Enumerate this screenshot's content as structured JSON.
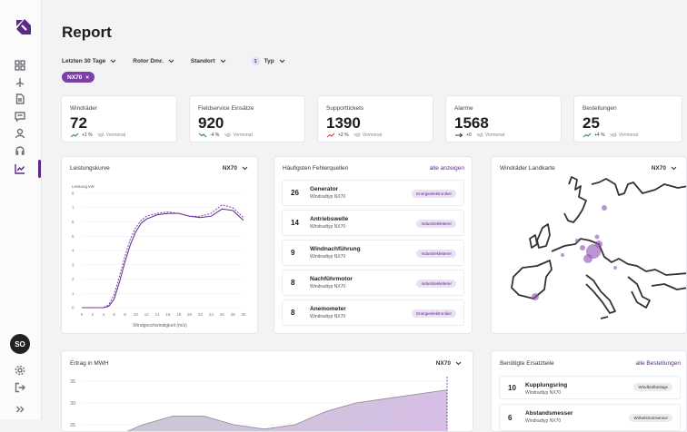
{
  "sidebar": {
    "avatar_initials": "SO",
    "nav_icons": [
      "dashboard-icon",
      "wind-turbine-icon",
      "document-icon",
      "message-icon",
      "user-icon",
      "headset-icon",
      "chart-icon"
    ],
    "active_index": 6,
    "bottom_icons": [
      "settings-icon",
      "logout-icon",
      "expand-icon"
    ]
  },
  "header": {
    "title": "Report"
  },
  "filters": [
    {
      "label": "Letzten 30 Tage",
      "badge": ""
    },
    {
      "label": "Rotor Dmr.",
      "badge": ""
    },
    {
      "label": "Standort",
      "badge": ""
    },
    {
      "label": "Typ",
      "badge": "1"
    }
  ],
  "active_chip": {
    "label": "NX70",
    "close": "×"
  },
  "kpis": [
    {
      "label": "Windräder",
      "value": "72",
      "delta": "+1 %",
      "compare": "vgl. Vormonat",
      "trend": "up"
    },
    {
      "label": "Fieldservice Einsätze",
      "value": "920",
      "delta": "-4 %",
      "compare": "vgl. Vormonat",
      "trend": "down"
    },
    {
      "label": "Supporttickets",
      "value": "1390",
      "delta": "+2 %",
      "compare": "vgl. Vormonat",
      "trend": "up-red"
    },
    {
      "label": "Alarme",
      "value": "1568",
      "delta": "+0",
      "compare": "vgl. Vormonat",
      "trend": "flat"
    },
    {
      "label": "Bestellungen",
      "value": "25",
      "delta": "+4 %",
      "compare": "vgl. Vormonat",
      "trend": "up"
    }
  ],
  "power_curve": {
    "title": "Leistungskurve",
    "selector": "NX70",
    "ylabel": "Leistung kW",
    "xlabel": "Windgeschwindigkeit (m/s)",
    "yticks": [
      "0",
      "1",
      "2",
      "3",
      "4",
      "5",
      "6",
      "7",
      "8"
    ],
    "xticks": [
      "0",
      "2",
      "4",
      "6",
      "8",
      "10",
      "12",
      "14",
      "16",
      "18",
      "20",
      "22",
      "24",
      "26",
      "28",
      "30"
    ]
  },
  "faults": {
    "title": "Häufigsten Fehlerquellen",
    "link": "alle anzeigen",
    "items": [
      {
        "count": "26",
        "name": "Generator",
        "sub": "Windradtyp NX70",
        "tag": "Energieelektroniker"
      },
      {
        "count": "14",
        "name": "Antriebswelle",
        "sub": "Windradtyp NX70",
        "tag": "Industriekletterer"
      },
      {
        "count": "9",
        "name": "Windnachführung",
        "sub": "Windradtyp NX70",
        "tag": "Industriekletterer"
      },
      {
        "count": "8",
        "name": "Nachführmotor",
        "sub": "Windradtyp NX70",
        "tag": "Industriekletterer"
      },
      {
        "count": "8",
        "name": "Anemometer",
        "sub": "Windradtyp NX70",
        "tag": "Energieelektroniker"
      }
    ]
  },
  "map": {
    "title": "Windräder Landkarte",
    "selector": "NX70"
  },
  "yield": {
    "title": "Ertrag in MWH",
    "selector": "NX70",
    "yticks": [
      "35",
      "30",
      "25"
    ]
  },
  "parts": {
    "title": "Benötigte Ersatzteile",
    "link": "alle Bestellungen",
    "items": [
      {
        "count": "10",
        "name": "Kupplungsring",
        "sub": "Windradtyp NX70",
        "tag": "Windkraftanlage"
      },
      {
        "count": "6",
        "name": "Abstandsmesser",
        "sub": "Windradtyp NX70",
        "tag": "Wirbelstromsensor"
      }
    ]
  },
  "chart_data": [
    {
      "type": "line",
      "title": "Leistungskurve",
      "xlabel": "Windgeschwindigkeit (m/s)",
      "ylabel": "Leistung kW",
      "xlim": [
        0,
        30
      ],
      "ylim": [
        0,
        8
      ],
      "grid": true,
      "x": [
        0,
        2,
        3,
        4,
        5,
        6,
        7,
        8,
        9,
        10,
        11,
        12,
        14,
        16,
        18,
        20,
        22,
        24,
        26,
        28,
        30
      ],
      "series": [
        {
          "values": [
            0,
            0,
            0,
            0,
            0.1,
            0.6,
            1.8,
            3.2,
            4.4,
            5.3,
            5.9,
            6.2,
            6.5,
            6.6,
            6.6,
            6.4,
            6.3,
            6.4,
            6.9,
            6.8,
            6.1
          ]
        },
        {
          "values": [
            0,
            0,
            0,
            0,
            0.2,
            0.9,
            2.2,
            3.6,
            4.8,
            5.6,
            6.1,
            6.4,
            6.6,
            6.7,
            6.6,
            6.4,
            6.4,
            6.6,
            7.2,
            7.0,
            6.3
          ]
        }
      ]
    },
    {
      "type": "area",
      "title": "Ertrag in MWH",
      "ylim": [
        20,
        35
      ],
      "x": [
        0,
        1,
        2,
        3,
        4,
        5,
        6,
        7,
        8,
        9,
        10,
        11,
        12
      ],
      "series": [
        {
          "values": [
            20,
            22,
            25,
            27,
            27,
            25,
            24,
            25,
            28,
            30,
            31,
            32,
            33
          ]
        }
      ]
    }
  ]
}
